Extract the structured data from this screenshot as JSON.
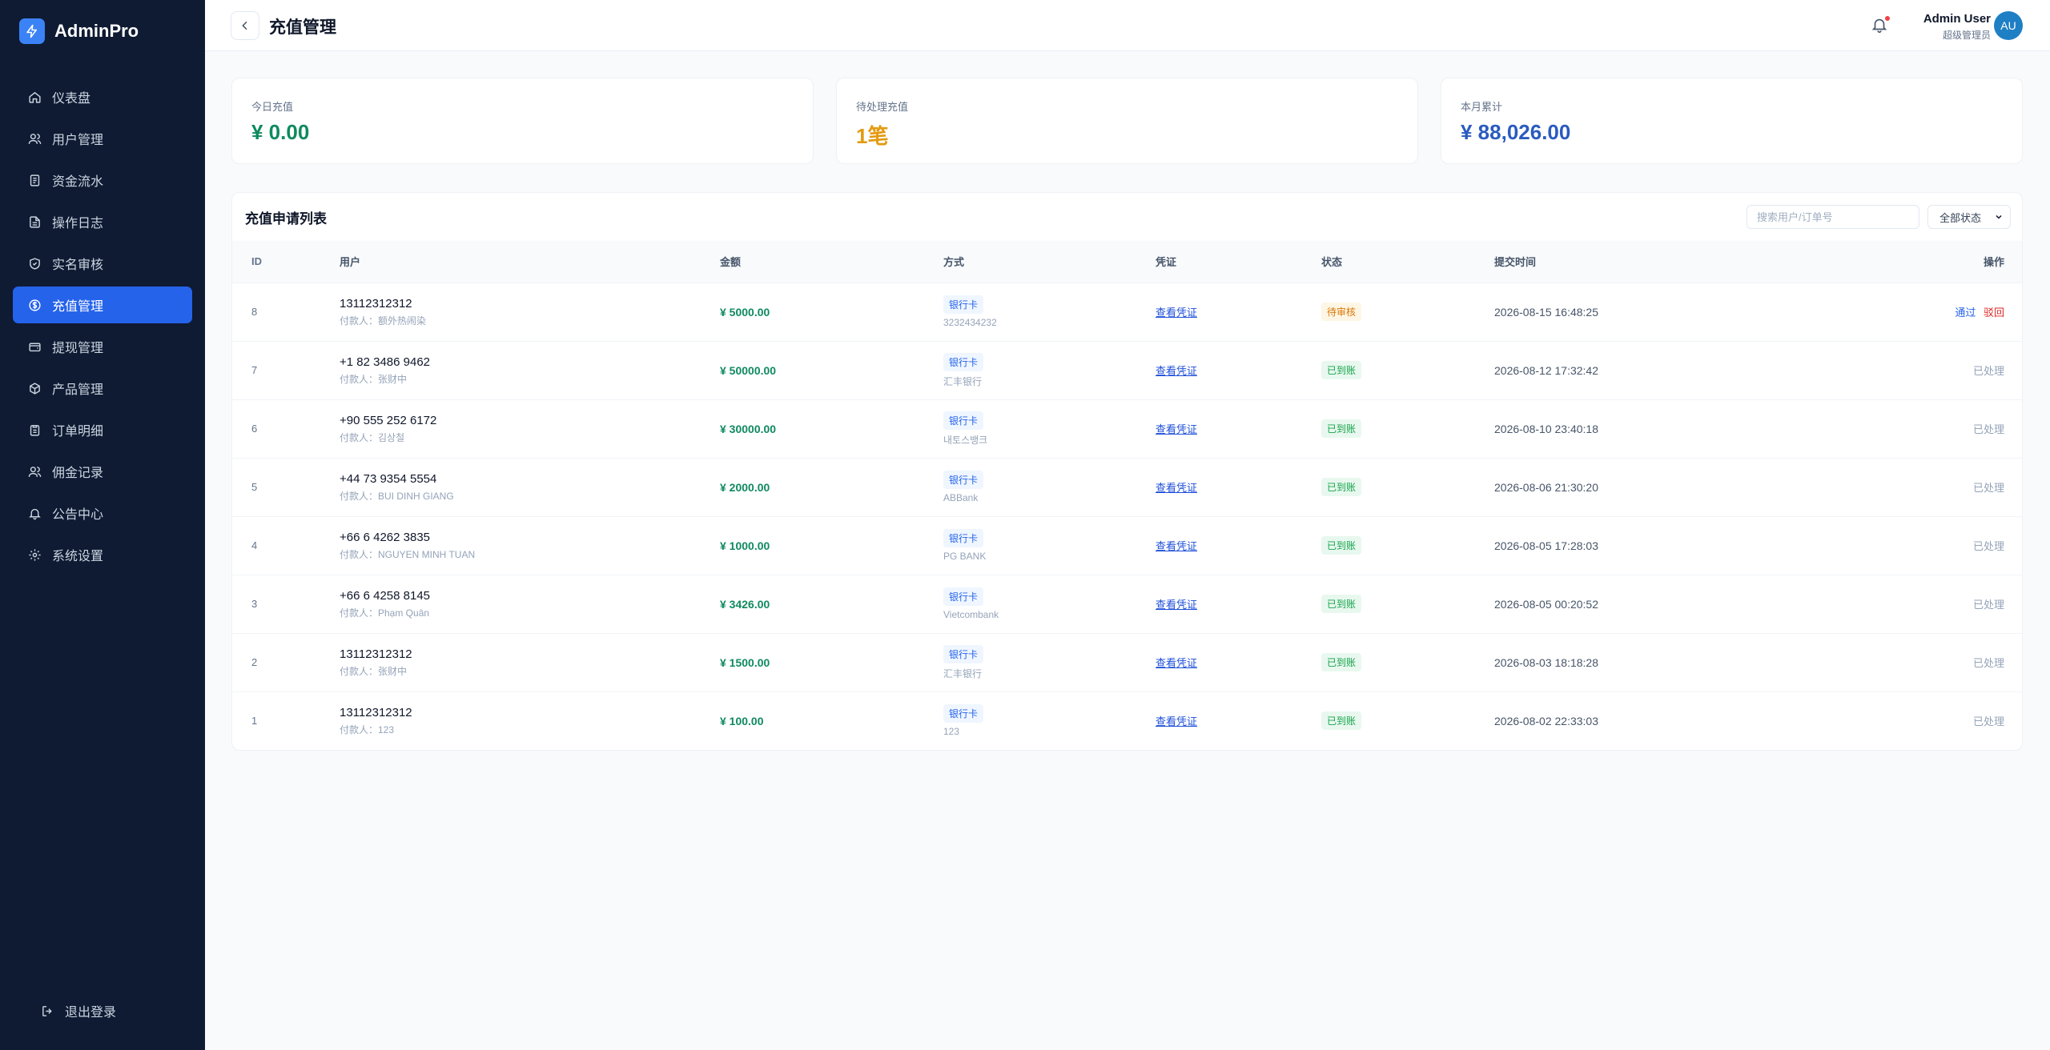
{
  "brand": {
    "name": "AdminPro"
  },
  "sidebar": {
    "items": [
      {
        "label": "仪表盘",
        "icon": "home-icon",
        "active": false
      },
      {
        "label": "用户管理",
        "icon": "users-icon",
        "active": false
      },
      {
        "label": "资金流水",
        "icon": "document-icon",
        "active": false
      },
      {
        "label": "操作日志",
        "icon": "file-text-icon",
        "active": false
      },
      {
        "label": "实名审核",
        "icon": "shield-check-icon",
        "active": false
      },
      {
        "label": "充值管理",
        "icon": "dollar-circle-icon",
        "active": true
      },
      {
        "label": "提现管理",
        "icon": "wallet-icon",
        "active": false
      },
      {
        "label": "产品管理",
        "icon": "box-icon",
        "active": false
      },
      {
        "label": "订单明细",
        "icon": "clipboard-icon",
        "active": false
      },
      {
        "label": "佣金记录",
        "icon": "users-icon",
        "active": false
      },
      {
        "label": "公告中心",
        "icon": "bell-icon",
        "active": false
      },
      {
        "label": "系统设置",
        "icon": "gear-icon",
        "active": false
      }
    ],
    "logout_label": "退出登录"
  },
  "header": {
    "title": "充值管理",
    "user_name": "Admin User",
    "user_role": "超级管理员",
    "avatar_initials": "AU"
  },
  "stats": [
    {
      "label": "今日充值",
      "value": "¥ 0.00",
      "color": "#0f8a5f"
    },
    {
      "label": "待处理充值",
      "value": "1笔",
      "color": "#e39a0f"
    },
    {
      "label": "本月累计",
      "value": "¥ 88,026.00",
      "color": "#2a5bbf"
    }
  ],
  "table": {
    "title": "充值申请列表",
    "search_placeholder": "搜索用户/订单号",
    "filter_value": "全部状态",
    "columns": {
      "id": "ID",
      "user": "用户",
      "amount": "金额",
      "method": "方式",
      "proof": "凭证",
      "status": "状态",
      "time": "提交时间",
      "op": "操作"
    },
    "rows": [
      {
        "id": "8",
        "phone": "13112312312",
        "payer": "付款人：额外热闹染",
        "amount": "¥ 5000.00",
        "method": "银行卡",
        "bank": "3232434232",
        "proof": "查看凭证",
        "status": "待审核",
        "status_type": "pending",
        "time": "2026-08-15 16:48:25",
        "op_approve": "通过",
        "op_reject": "驳回"
      },
      {
        "id": "7",
        "phone": "+1 82 3486 9462",
        "payer": "付款人：张财中",
        "amount": "¥ 50000.00",
        "method": "银行卡",
        "bank": "汇丰银行",
        "proof": "查看凭证",
        "status": "已到账",
        "status_type": "done",
        "time": "2026-08-12 17:32:42",
        "op_done": "已处理"
      },
      {
        "id": "6",
        "phone": "+90 555 252 6172",
        "payer": "付款人：김상철",
        "amount": "¥ 30000.00",
        "method": "银行卡",
        "bank": "내토스뱅크",
        "proof": "查看凭证",
        "status": "已到账",
        "status_type": "done",
        "time": "2026-08-10 23:40:18",
        "op_done": "已处理"
      },
      {
        "id": "5",
        "phone": "+44 73 9354 5554",
        "payer": "付款人：BUI DINH GIANG",
        "amount": "¥ 2000.00",
        "method": "银行卡",
        "bank": "ABBank",
        "proof": "查看凭证",
        "status": "已到账",
        "status_type": "done",
        "time": "2026-08-06 21:30:20",
        "op_done": "已处理"
      },
      {
        "id": "4",
        "phone": "+66 6 4262 3835",
        "payer": "付款人：NGUYEN MINH TUAN",
        "amount": "¥ 1000.00",
        "method": "银行卡",
        "bank": "PG BANK",
        "proof": "查看凭证",
        "status": "已到账",
        "status_type": "done",
        "time": "2026-08-05 17:28:03",
        "op_done": "已处理"
      },
      {
        "id": "3",
        "phone": "+66 6 4258 8145",
        "payer": "付款人：Phạm Quân",
        "amount": "¥ 3426.00",
        "method": "银行卡",
        "bank": "Vietcombank",
        "proof": "查看凭证",
        "status": "已到账",
        "status_type": "done",
        "time": "2026-08-05 00:20:52",
        "op_done": "已处理"
      },
      {
        "id": "2",
        "phone": "13112312312",
        "payer": "付款人：张财中",
        "amount": "¥ 1500.00",
        "method": "银行卡",
        "bank": "汇丰银行",
        "proof": "查看凭证",
        "status": "已到账",
        "status_type": "done",
        "time": "2026-08-03 18:18:28",
        "op_done": "已处理"
      },
      {
        "id": "1",
        "phone": "13112312312",
        "payer": "付款人：123",
        "amount": "¥ 100.00",
        "method": "银行卡",
        "bank": "123",
        "proof": "查看凭证",
        "status": "已到账",
        "status_type": "done",
        "time": "2026-08-02 22:33:03",
        "op_done": "已处理"
      }
    ]
  }
}
